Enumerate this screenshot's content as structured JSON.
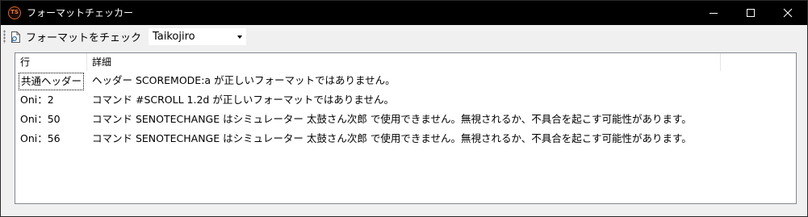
{
  "window": {
    "title": "フォーマットチェッカー",
    "icon_text": "TS"
  },
  "toolbar": {
    "check_label": "フォーマットをチェック",
    "simulator_selected": "Taikojiro"
  },
  "list": {
    "columns": [
      "行",
      "詳細"
    ],
    "rows": [
      {
        "line": "共通ヘッダー",
        "detail": "ヘッダー SCOREMODE:a が正しいフォーマットではありません。"
      },
      {
        "line": "Oni：2",
        "detail": "コマンド #SCROLL 1.2d が正しいフォーマットではありません。"
      },
      {
        "line": "Oni：50",
        "detail": "コマンド SENOTECHANGE はシミュレーター 太鼓さん次郎 で使用できません。無視されるか、不具合を起こす可能性があります。"
      },
      {
        "line": "Oni：56",
        "detail": "コマンド SENOTECHANGE はシミュレーター 太鼓さん次郎 で使用できません。無視されるか、不具合を起こす可能性があります。"
      }
    ]
  }
}
